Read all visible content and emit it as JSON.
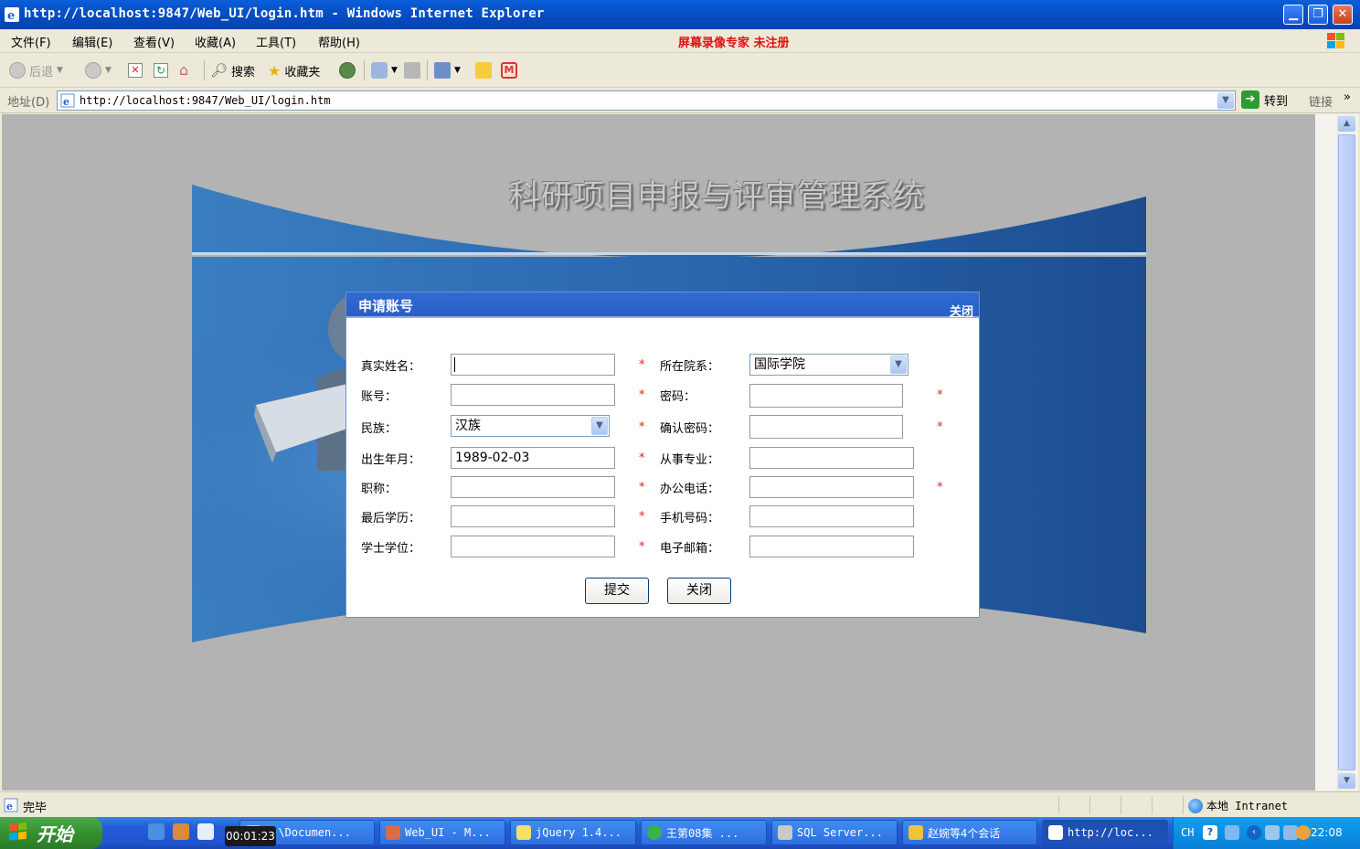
{
  "window": {
    "title": "http://localhost:9847/Web_UI/login.htm - Windows Internet Explorer",
    "min_glyph": "▁",
    "max_glyph": "❐",
    "close_glyph": "✕"
  },
  "menu": {
    "items": [
      "文件(F)",
      "编辑(E)",
      "查看(V)",
      "收藏(A)",
      "工具(T)",
      "帮助(H)"
    ],
    "recorder_notice": "屏幕录像专家  未注册"
  },
  "toolbar": {
    "back_label": "后退",
    "search_label": "搜索",
    "favorites_label": "收藏夹"
  },
  "address": {
    "label": "地址(D)",
    "url": "http://localhost:9847/Web_UI/login.htm",
    "go_label": "转到",
    "links_label": "链接"
  },
  "page": {
    "system_title": "科研项目申报与评审管理系统"
  },
  "dialog": {
    "title": "申请账号",
    "close_link": "关闭",
    "fields": {
      "real_name_label": "真实姓名：",
      "real_name_value": "",
      "department_label": "所在院系：",
      "department_value": "国际学院",
      "account_label": "账号：",
      "account_value": "",
      "password_label": "密码：",
      "password_value": "",
      "ethnicity_label": "民族：",
      "ethnicity_value": "汉族",
      "confirm_password_label": "确认密码：",
      "confirm_password_value": "",
      "birthdate_label": "出生年月：",
      "birthdate_value": "1989-02-03",
      "major_label": "从事专业：",
      "major_value": "",
      "title_label": "职称：",
      "title_value": "",
      "office_phone_label": "办公电话：",
      "office_phone_value": "",
      "education_label": "最后学历：",
      "education_value": "",
      "mobile_label": "手机号码：",
      "mobile_value": "",
      "degree_label": "学士学位：",
      "degree_value": "",
      "email_label": "电子邮箱：",
      "email_value": ""
    },
    "required_mark": "*",
    "submit_label": "提交",
    "close_label": "关闭"
  },
  "status": {
    "text": "完毕",
    "zone": "本地 Intranet"
  },
  "taskbar": {
    "start_label": "开始",
    "timer": "00:01:23",
    "tasks": [
      "C:\\Documen...",
      "Web_UI - M...",
      "jQuery 1.4...",
      "王第08集   ...",
      "SQL Server...",
      "赵婉等4个会话",
      "http://loc..."
    ],
    "lang": "CH",
    "clock": "22:08"
  },
  "colors": {
    "title_bar": "#0650c8",
    "banner_blue": "#2d6ab4",
    "dialog_header": "#2f6bd1",
    "required_red": "#d22222",
    "start_green": "#36902f"
  }
}
